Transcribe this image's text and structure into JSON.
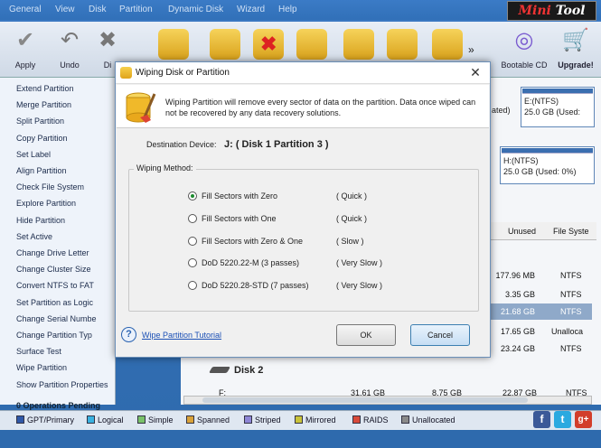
{
  "menu": [
    "General",
    "View",
    "Disk",
    "Partition",
    "Dynamic Disk",
    "Wizard",
    "Help"
  ],
  "brand": {
    "part1": "Mini",
    "part2": "Tool"
  },
  "toolbar": {
    "apply": "Apply",
    "undo": "Undo",
    "discard": "Di",
    "bootable_cd": "Bootable CD",
    "upgrade": "Upgrade!",
    "more": "»"
  },
  "sidebar": {
    "items": [
      "Extend Partition",
      "Merge Partition",
      "Split Partition",
      "Copy Partition",
      "Set Label",
      "Align Partition",
      "Check File System",
      "Explore Partition",
      "Hide Partition",
      "Set Active",
      "Change Drive Letter",
      "Change Cluster Size",
      "Convert NTFS to FAT",
      "Set Partition as Logic",
      "Change Serial Numbe",
      "Change Partition Typ",
      "Surface Test",
      "Wipe Partition",
      "Show Partition Properties"
    ],
    "pending": "0 Operations Pending"
  },
  "diskmap": {
    "seg1_prefix": "ated)",
    "seg2_label": "E:(NTFS)",
    "seg2_size": "25.0 GB (Used:",
    "seg3_label": "H:(NTFS)",
    "seg3_size": "25.0 GB (Used: 0%)"
  },
  "table": {
    "col_unused": "Unused",
    "col_fs": "File Syste",
    "rows": [
      {
        "unused": "177.96 MB",
        "fs": "NTFS"
      },
      {
        "unused": "3.35 GB",
        "fs": "NTFS"
      },
      {
        "unused": "21.68 GB",
        "fs": "NTFS"
      },
      {
        "unused": "17.65 GB",
        "fs": "Unalloca"
      },
      {
        "unused": "23.24 GB",
        "fs": "NTFS"
      }
    ],
    "disk2": "Disk 2",
    "last_row": {
      "name": "F:",
      "capacity": "31.61 GB",
      "used": "8.75 GB",
      "unused": "22.87 GB",
      "fs": "NTFS"
    }
  },
  "legend": [
    "GPT/Primary",
    "Logical",
    "Simple",
    "Spanned",
    "Striped",
    "Mirrored",
    "RAIDS",
    "Unallocated"
  ],
  "legend_colors": [
    "#2f58a8",
    "#3ab2e0",
    "#7ac26a",
    "#d9a23a",
    "#8e86d6",
    "#c9c33a",
    "#d84a3a",
    "#8a8a8a"
  ],
  "social": {
    "facebook": "f",
    "twitter": "t",
    "google": "g+"
  },
  "dialog": {
    "title": "Wiping Disk or Partition",
    "close": "✕",
    "message": "Wiping Partition will remove every sector of data on the partition. Data once wiped can not be recovered by any data recovery solutions.",
    "dest_label": "Destination Device:",
    "dest_value": "J: ( Disk 1 Partition 3 )",
    "method_label": "Wiping Method:",
    "options": [
      {
        "label": "Fill Sectors with Zero",
        "speed": "( Quick )"
      },
      {
        "label": "Fill Sectors with One",
        "speed": "( Quick )"
      },
      {
        "label": "Fill Sectors with Zero & One",
        "speed": "( Slow )"
      },
      {
        "label": "DoD 5220.22-M (3 passes)",
        "speed": "( Very Slow )"
      },
      {
        "label": "DoD 5220.28-STD (7 passes)",
        "speed": "( Very Slow )"
      }
    ],
    "selected_option": 0,
    "help_link": "Wipe Partition Tutorial",
    "ok": "OK",
    "cancel": "Cancel"
  }
}
